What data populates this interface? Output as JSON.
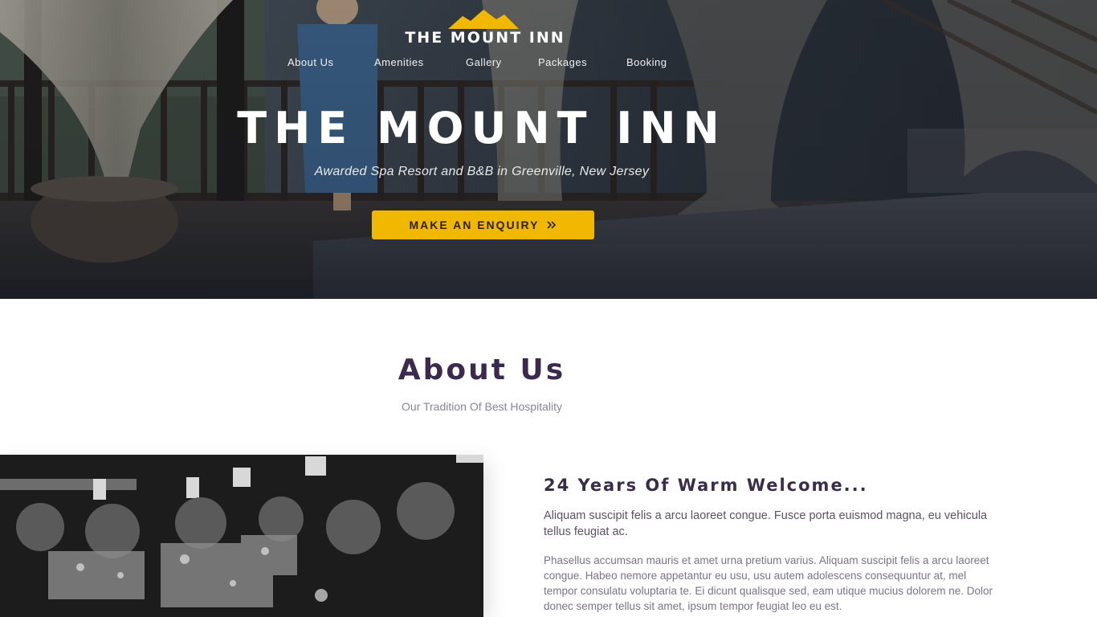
{
  "brand": {
    "logo_text": "THE MOUNT INN",
    "accent_color": "#f0b800"
  },
  "nav": {
    "items": [
      {
        "label": "About Us"
      },
      {
        "label": "Amenities"
      },
      {
        "label": "Gallery"
      },
      {
        "label": "Packages"
      },
      {
        "label": "Booking"
      }
    ]
  },
  "hero": {
    "title": "THE MOUNT INN",
    "subtitle": "Awarded Spa Resort and B&B in Greenville, New Jersey",
    "cta_label": "MAKE AN ENQUIRY",
    "cta_icon": "double-chevron-right-icon"
  },
  "about": {
    "title": "About Us",
    "subtitle": "Our Tradition Of Best Hospitality",
    "heading": "24 Years Of Warm Welcome...",
    "lead": "Aliquam suscipit felis a arcu laoreet congue. Fusce porta euismod magna, eu vehicula tellus feugiat ac.",
    "body": "Phasellus accumsan mauris et amet urna pretium varius. Aliquam suscipit felis a arcu laoreet congue. Habeo nemore appetantur eu usu, usu autem adolescens consequuntur at, mel tempor consulatu voluptaria te. Ei dicunt qualisque sed, eam utique mucius dolorem ne. Dolor donec semper tellus sit amet, ipsum tempor feugiat leo eu est."
  }
}
